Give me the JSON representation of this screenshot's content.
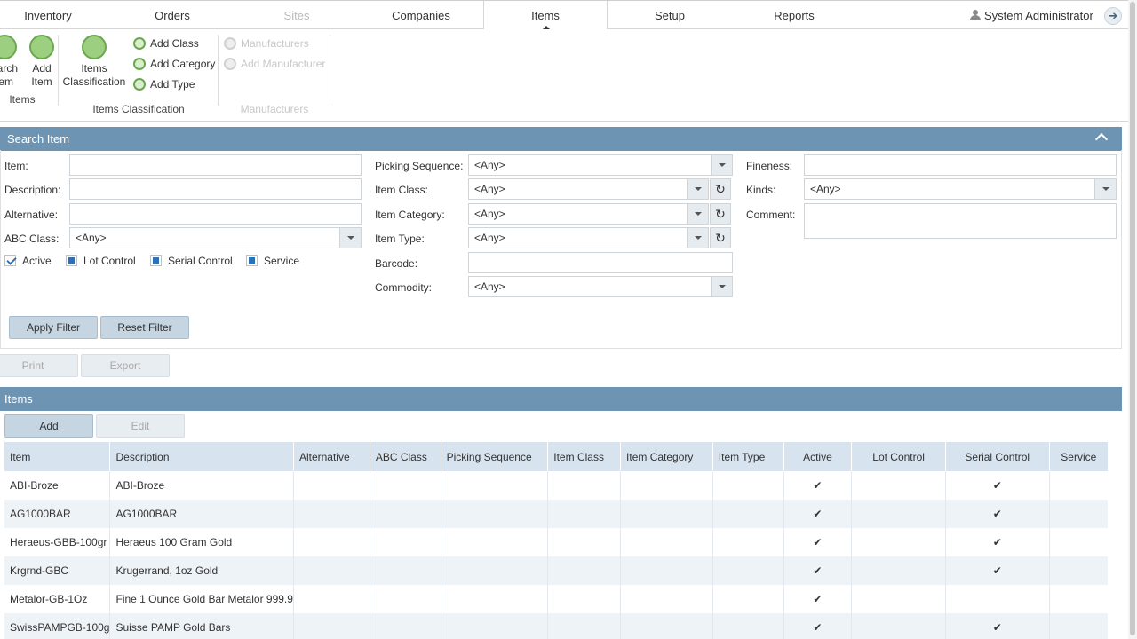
{
  "nav": {
    "tabs": [
      {
        "label": "Inventory"
      },
      {
        "label": "Orders"
      },
      {
        "label": "Sites"
      },
      {
        "label": "Companies"
      },
      {
        "label": "Items"
      },
      {
        "label": "Setup"
      },
      {
        "label": "Reports"
      }
    ],
    "active_tab": "Items",
    "user": "System Administrator"
  },
  "ribbon": {
    "search_item": "earch\ntem",
    "search_item_l1": "earch",
    "search_item_l2": "tem",
    "add_item_l1": "Add",
    "add_item_l2": "Item",
    "items_group": "Items",
    "items_classification_l1": "Items",
    "items_classification_l2": "Classification",
    "add_class": "Add Class",
    "add_category": "Add Category",
    "add_type": "Add Type",
    "classification_group": "Items Classification",
    "manufacturers": "Manufacturers",
    "add_manufacturer": "Add Manufacturer",
    "manufacturers_group": "Manufacturers"
  },
  "search": {
    "title": "Search Item",
    "item_label": "Item:",
    "description_label": "Description:",
    "alternative_label": "Alternative:",
    "abc_class_label": "ABC Class:",
    "abc_class_value": "<Any>",
    "picking_sequence_label": "Picking Sequence:",
    "picking_sequence_value": "<Any>",
    "item_class_label": "Item Class:",
    "item_class_value": "<Any>",
    "item_category_label": "Item Category:",
    "item_category_value": "<Any>",
    "item_type_label": "Item Type:",
    "item_type_value": "<Any>",
    "barcode_label": "Barcode:",
    "commodity_label": "Commodity:",
    "commodity_value": "<Any>",
    "fineness_label": "Fineness:",
    "kinds_label": "Kinds:",
    "kinds_value": "<Any>",
    "comment_label": "Comment:",
    "active_label": "Active",
    "lot_control_label": "Lot Control",
    "serial_control_label": "Serial Control",
    "service_label": "Service",
    "apply_filter": "Apply Filter",
    "reset_filter": "Reset Filter"
  },
  "actions": {
    "print": "Print",
    "export": "Export"
  },
  "items": {
    "title": "Items",
    "add": "Add",
    "edit": "Edit",
    "columns": [
      "Item",
      "Description",
      "Alternative",
      "ABC Class",
      "Picking Sequence",
      "Item Class",
      "Item Category",
      "Item Type",
      "Active",
      "Lot Control",
      "Serial Control",
      "Service"
    ],
    "rows": [
      {
        "item": "ABI-Broze",
        "description": "ABI-Broze",
        "active": "✔",
        "serial": "✔"
      },
      {
        "item": "AG1000BAR",
        "description": "AG1000BAR",
        "active": "✔",
        "serial": "✔"
      },
      {
        "item": "Heraeus-GBB-100gr",
        "description": "Heraeus 100 Gram Gold",
        "active": "✔",
        "serial": "✔"
      },
      {
        "item": "Krgrnd-GBC",
        "description": "Krugerrand, 1oz Gold",
        "active": "✔",
        "serial": "✔"
      },
      {
        "item": "Metalor-GB-1Oz",
        "description": "Fine 1 Ounce Gold Bar Metalor 999.9",
        "active": "✔",
        "serial": ""
      },
      {
        "item": "SwissPAMPGB-100g",
        "description": "Suisse PAMP Gold Bars",
        "active": "✔",
        "serial": "✔"
      }
    ]
  }
}
